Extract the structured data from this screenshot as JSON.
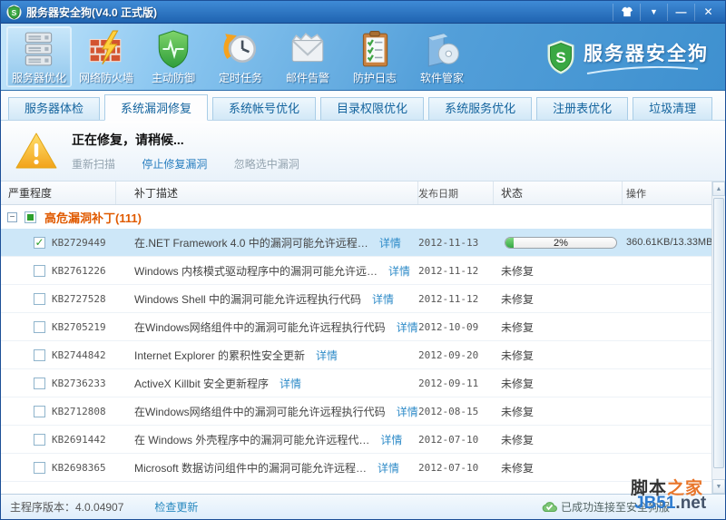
{
  "window": {
    "title": "服务器安全狗(V4.0 正式版)"
  },
  "icons": {
    "check": "✓",
    "expand": "−",
    "scroll_up": "▲",
    "scroll_down": "▼",
    "minimize": "—",
    "close": "✕",
    "menu_caret": "▼"
  },
  "toolbar": {
    "brand": "服务器安全狗",
    "items": [
      {
        "label": "服务器优化",
        "icon": "server-icon",
        "active": true
      },
      {
        "label": "网络防火墙",
        "icon": "firewall-icon",
        "active": false
      },
      {
        "label": "主动防御",
        "icon": "shield-icon",
        "active": false
      },
      {
        "label": "定时任务",
        "icon": "clock-icon",
        "active": false
      },
      {
        "label": "邮件告警",
        "icon": "mail-icon",
        "active": false
      },
      {
        "label": "防护日志",
        "icon": "log-icon",
        "active": false
      },
      {
        "label": "软件管家",
        "icon": "software-icon",
        "active": false
      }
    ]
  },
  "tabs": {
    "items": [
      {
        "label": "服务器体检",
        "active": false
      },
      {
        "label": "系统漏洞修复",
        "active": true
      },
      {
        "label": "系统帐号优化",
        "active": false
      },
      {
        "label": "目录权限优化",
        "active": false
      },
      {
        "label": "系统服务优化",
        "active": false
      },
      {
        "label": "注册表优化",
        "active": false
      },
      {
        "label": "垃圾清理",
        "active": false
      }
    ]
  },
  "status_panel": {
    "title": "正在修复，请稍候...",
    "actions": [
      {
        "label": "重新扫描",
        "enabled": false
      },
      {
        "label": "停止修复漏洞",
        "enabled": true
      },
      {
        "label": "忽略选中漏洞",
        "enabled": false
      }
    ]
  },
  "table": {
    "columns": [
      "严重程度",
      "补丁描述",
      "发布日期",
      "状态",
      "操作"
    ],
    "group_label": "高危漏洞补丁(111)",
    "detail_label": "详情",
    "rows": [
      {
        "kb": "KB2729449",
        "checked": true,
        "selected": true,
        "desc": "在.NET Framework 4.0 中的漏洞可能允许远程…",
        "date": "2012-11-13",
        "status": "progress",
        "progress_pct": "2%",
        "progress_value": 2,
        "action": "360.61KB/13.33MB"
      },
      {
        "kb": "KB2761226",
        "checked": false,
        "selected": false,
        "desc": "Windows 内核模式驱动程序中的漏洞可能允许远…",
        "date": "2012-11-12",
        "status": "未修复",
        "action": ""
      },
      {
        "kb": "KB2727528",
        "checked": false,
        "selected": false,
        "desc": "Windows Shell 中的漏洞可能允许远程执行代码",
        "date": "2012-11-12",
        "status": "未修复",
        "action": ""
      },
      {
        "kb": "KB2705219",
        "checked": false,
        "selected": false,
        "desc": "在Windows网络组件中的漏洞可能允许远程执行代码",
        "date": "2012-10-09",
        "status": "未修复",
        "action": ""
      },
      {
        "kb": "KB2744842",
        "checked": false,
        "selected": false,
        "desc": "Internet Explorer 的累积性安全更新",
        "date": "2012-09-20",
        "status": "未修复",
        "action": ""
      },
      {
        "kb": "KB2736233",
        "checked": false,
        "selected": false,
        "desc": "ActiveX Killbit 安全更新程序",
        "date": "2012-09-11",
        "status": "未修复",
        "action": ""
      },
      {
        "kb": "KB2712808",
        "checked": false,
        "selected": false,
        "desc": "在Windows网络组件中的漏洞可能允许远程执行代码",
        "date": "2012-08-15",
        "status": "未修复",
        "action": ""
      },
      {
        "kb": "KB2691442",
        "checked": false,
        "selected": false,
        "desc": "在 Windows 外壳程序中的漏洞可能允许远程代…",
        "date": "2012-07-10",
        "status": "未修复",
        "action": ""
      },
      {
        "kb": "KB2698365",
        "checked": false,
        "selected": false,
        "desc": "Microsoft 数据访问组件中的漏洞可能允许远程…",
        "date": "2012-07-10",
        "status": "未修复",
        "action": ""
      }
    ]
  },
  "footer": {
    "version_label": "主程序版本：4.0.04907",
    "check_update": "检查更新",
    "connection": "已成功连接至安全狗服"
  },
  "watermark": {
    "part1": "脚本",
    "part2": "之家",
    "part3": "JB51",
    "part4": ".net"
  }
}
